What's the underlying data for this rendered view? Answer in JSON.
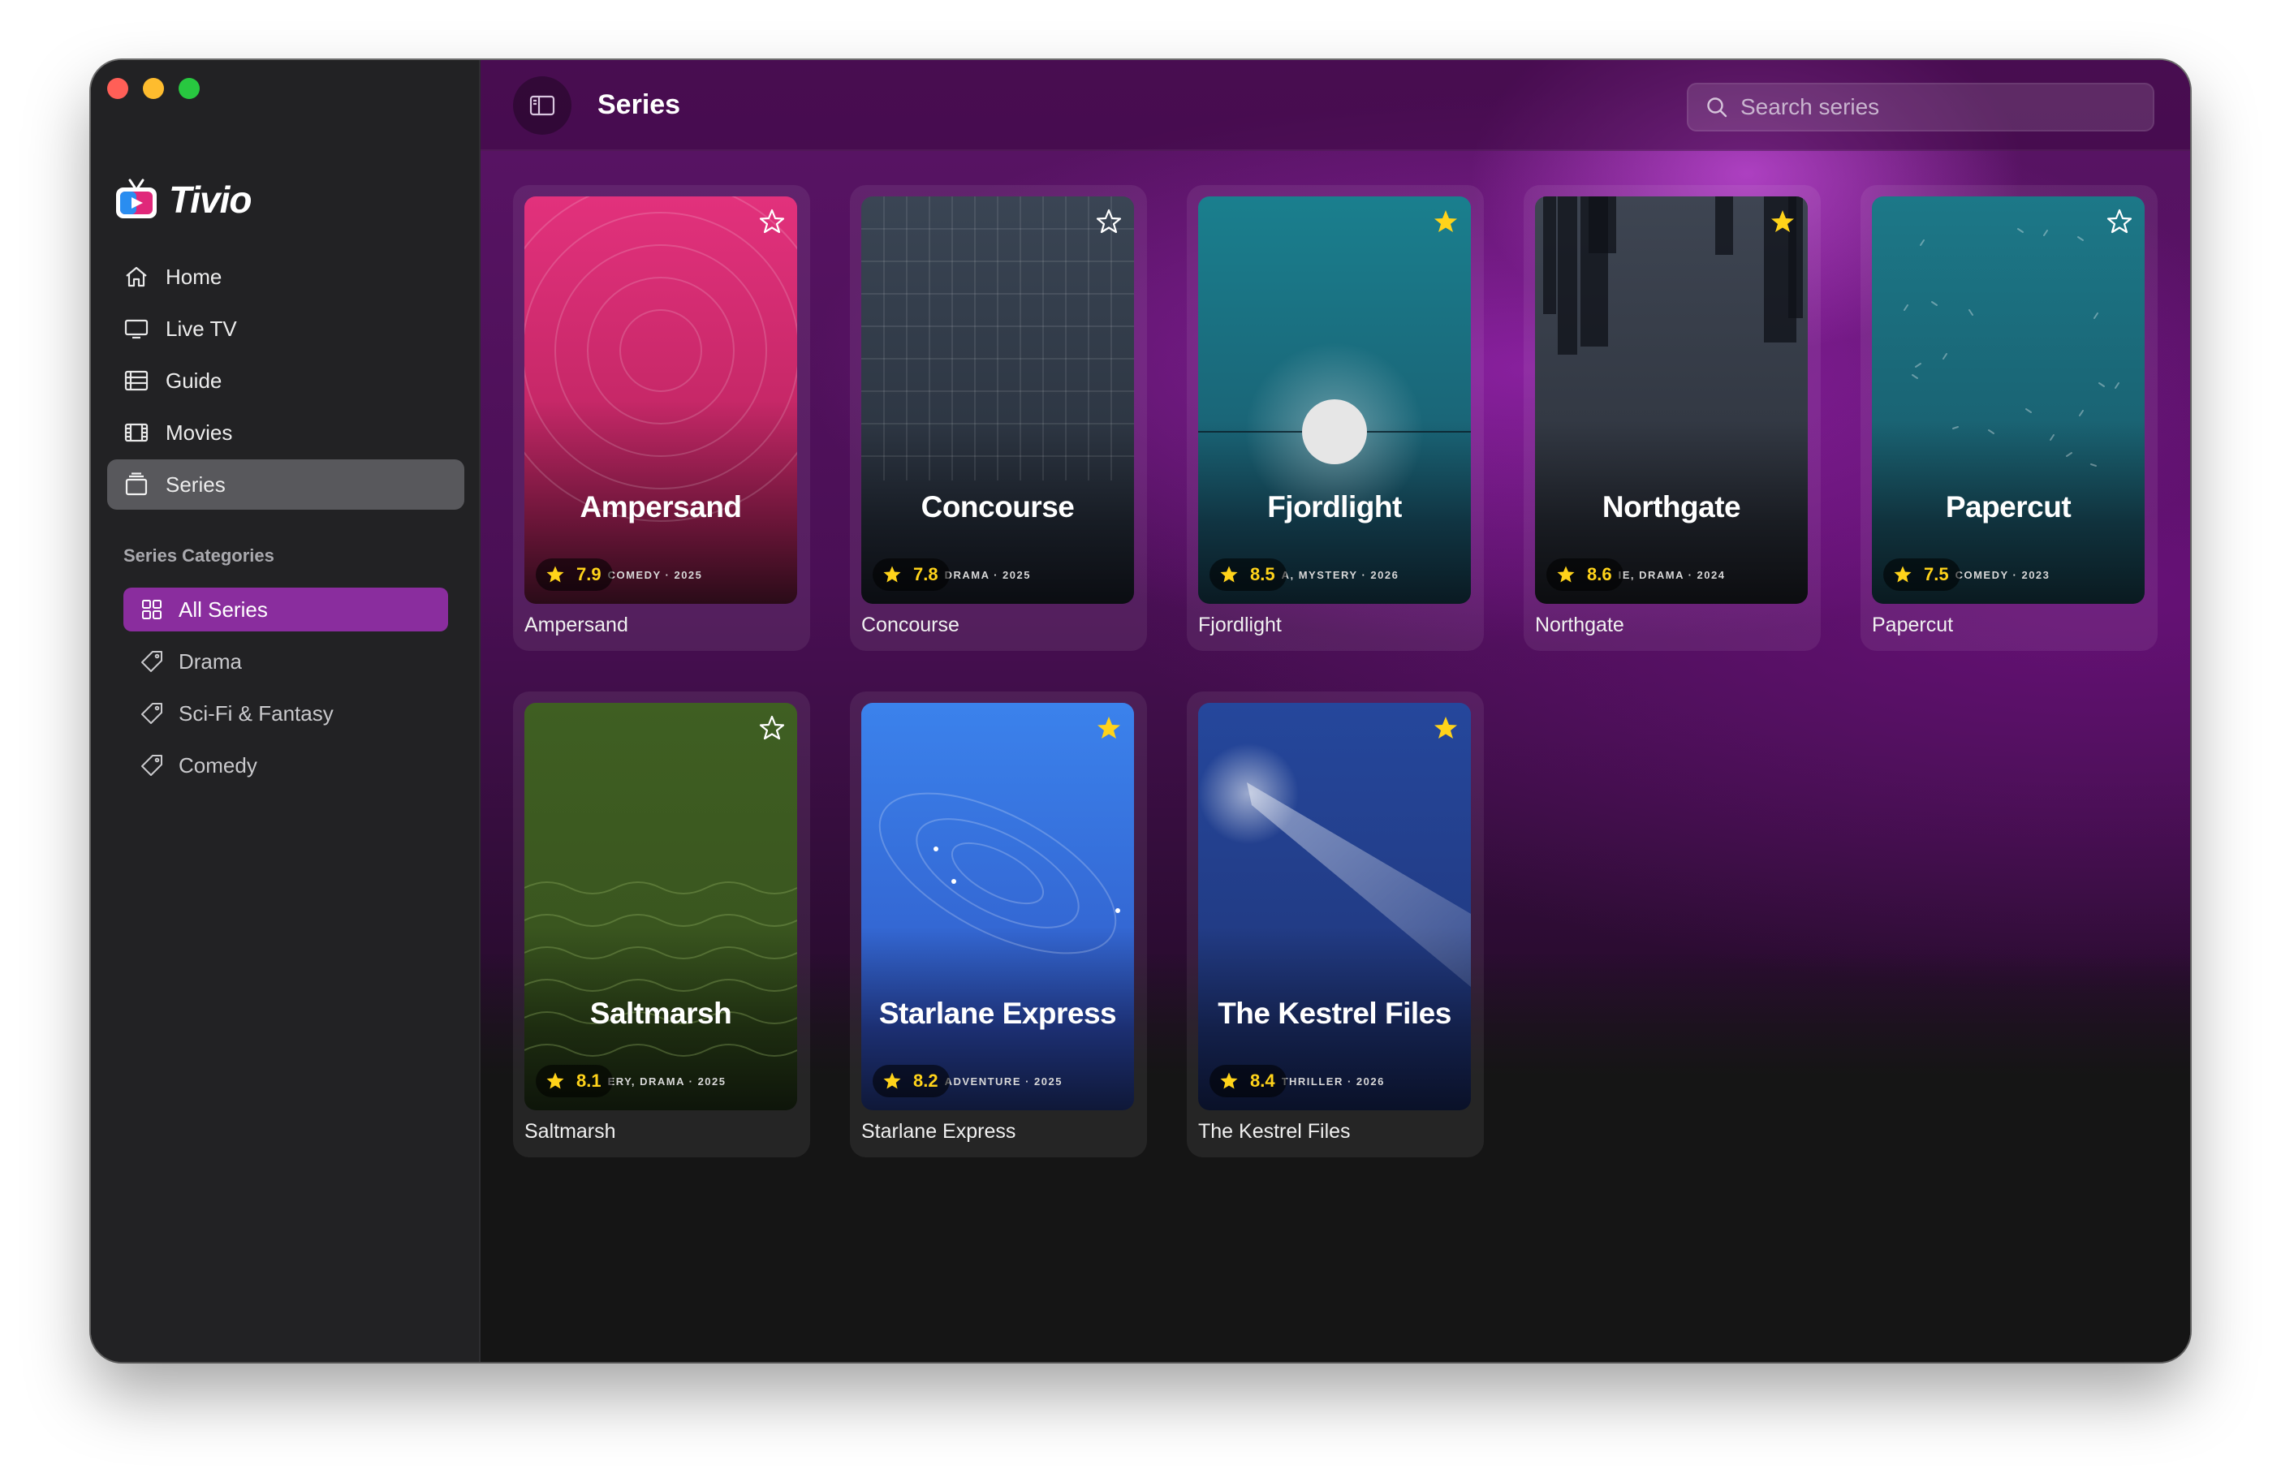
{
  "app": {
    "name": "Tivio"
  },
  "nav": [
    {
      "label": "Home",
      "icon": "home-icon"
    },
    {
      "label": "Live TV",
      "icon": "tv-icon"
    },
    {
      "label": "Guide",
      "icon": "guide-icon"
    },
    {
      "label": "Movies",
      "icon": "film-icon"
    },
    {
      "label": "Series",
      "icon": "series-icon",
      "active": true
    }
  ],
  "categories": {
    "title": "Series Categories",
    "items": [
      {
        "label": "All Series",
        "icon": "grid-icon",
        "active": true
      },
      {
        "label": "Drama",
        "icon": "tag-icon"
      },
      {
        "label": "Sci-Fi & Fantasy",
        "icon": "tag-icon"
      },
      {
        "label": "Comedy",
        "icon": "tag-icon"
      }
    ]
  },
  "header": {
    "title": "Series",
    "search_placeholder": "Search series"
  },
  "series": [
    {
      "title": "Ampersand",
      "rating": "7.9",
      "meta": "COMEDY · 2025",
      "favorite": false
    },
    {
      "title": "Concourse",
      "rating": "7.8",
      "meta": "DRAMA · 2025",
      "favorite": false
    },
    {
      "title": "Fjordlight",
      "rating": "8.5",
      "meta": "A, MYSTERY · 2026",
      "favorite": true
    },
    {
      "title": "Northgate",
      "rating": "8.6",
      "meta": "IE, DRAMA · 2024",
      "favorite": true
    },
    {
      "title": "Papercut",
      "rating": "7.5",
      "meta": "COMEDY · 2023",
      "favorite": false
    },
    {
      "title": "Saltmarsh",
      "rating": "8.1",
      "meta": "ERY, DRAMA · 2025",
      "favorite": false
    },
    {
      "title": "Starlane Express",
      "rating": "8.2",
      "meta": "ADVENTURE · 2025",
      "favorite": true
    },
    {
      "title": "The Kestrel Files",
      "rating": "8.4",
      "meta": "THRILLER · 2026",
      "favorite": true
    }
  ],
  "colors": {
    "accent": "#8a2d9e",
    "star": "#ffd31a"
  }
}
